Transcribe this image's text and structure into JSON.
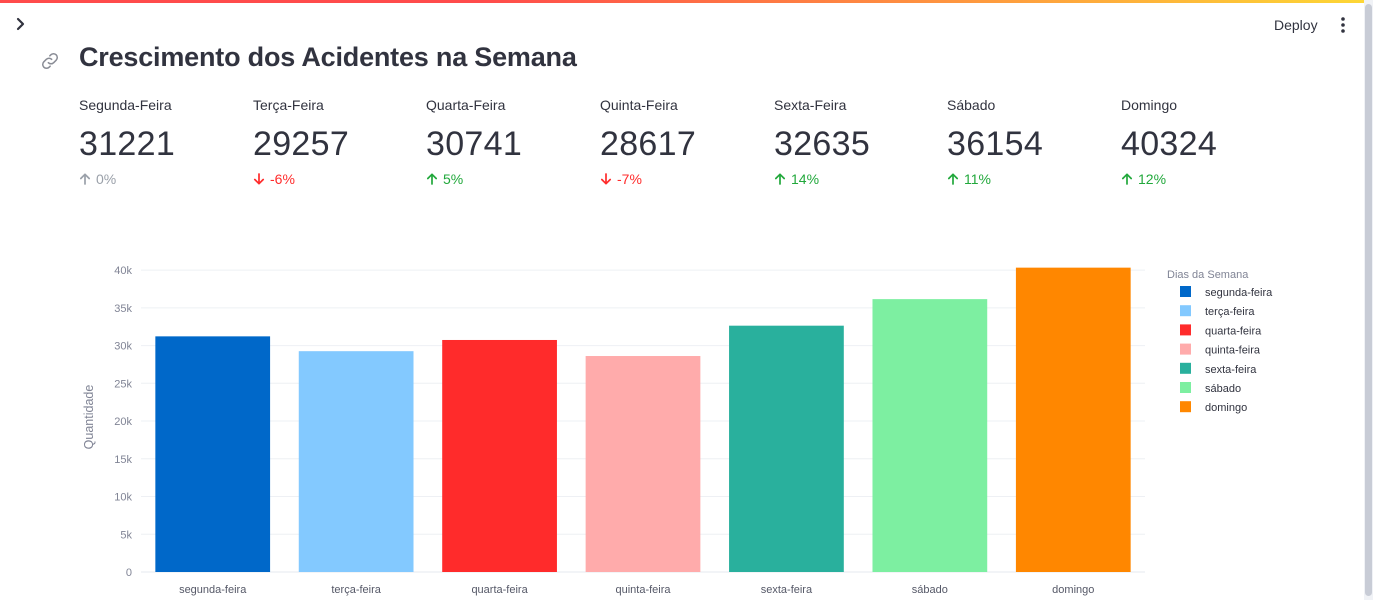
{
  "header": {
    "deploy_label": "Deploy"
  },
  "page": {
    "title": "Crescimento dos Acidentes na Semana"
  },
  "colors": {
    "delta_up": "#21a83b",
    "delta_down": "#ff2b2b",
    "delta_neutral": "#9aa0a9"
  },
  "metrics": [
    {
      "label": "Segunda-Feira",
      "value": "31221",
      "delta": "0%",
      "direction": "neutral"
    },
    {
      "label": "Terça-Feira",
      "value": "29257",
      "delta": "-6%",
      "direction": "down"
    },
    {
      "label": "Quarta-Feira",
      "value": "30741",
      "delta": "5%",
      "direction": "up"
    },
    {
      "label": "Quinta-Feira",
      "value": "28617",
      "delta": "-7%",
      "direction": "down"
    },
    {
      "label": "Sexta-Feira",
      "value": "32635",
      "delta": "14%",
      "direction": "up"
    },
    {
      "label": "Sábado",
      "value": "36154",
      "delta": "11%",
      "direction": "up"
    },
    {
      "label": "Domingo",
      "value": "40324",
      "delta": "12%",
      "direction": "up"
    }
  ],
  "chart_data": {
    "type": "bar",
    "title": "",
    "xlabel": "",
    "ylabel": "Quantidade",
    "ylim": [
      0,
      42000
    ],
    "grid": true,
    "yticks": [
      0,
      5000,
      10000,
      15000,
      20000,
      25000,
      30000,
      35000,
      40000
    ],
    "ytick_labels": [
      "0",
      "5k",
      "10k",
      "15k",
      "20k",
      "25k",
      "30k",
      "35k",
      "40k"
    ],
    "categories": [
      "segunda-feira",
      "terça-feira",
      "quarta-feira",
      "quinta-feira",
      "sexta-feira",
      "sábado",
      "domingo"
    ],
    "values": [
      31221,
      29257,
      30741,
      28617,
      32635,
      36154,
      40324
    ],
    "colors": [
      "#0068c9",
      "#83c9ff",
      "#ff2b2b",
      "#ffabab",
      "#29b09d",
      "#7defa1",
      "#ff8700"
    ],
    "legend_title": "Dias da Semana",
    "legend_position": "right",
    "legend": [
      "segunda-feira",
      "terça-feira",
      "quarta-feira",
      "quinta-feira",
      "sexta-feira",
      "sábado",
      "domingo"
    ]
  }
}
